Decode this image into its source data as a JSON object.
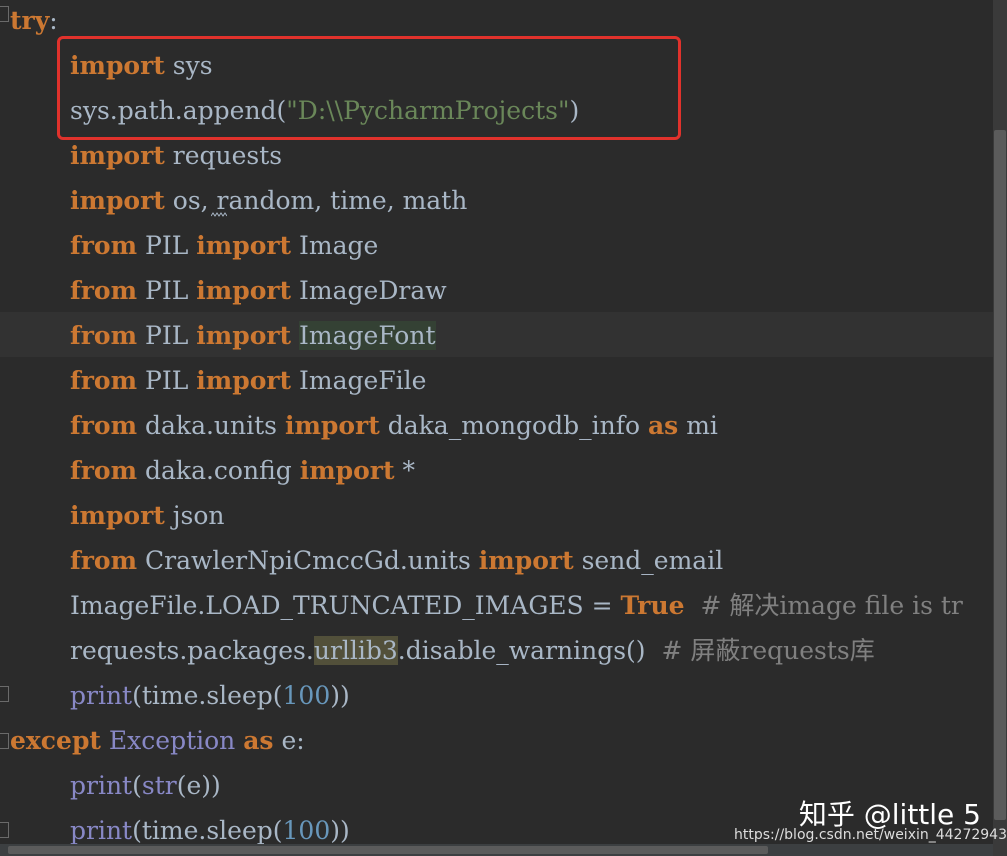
{
  "code": {
    "l1": {
      "kw": "try",
      "rest": ":"
    },
    "l2": {
      "kw": "import",
      "rest": " sys"
    },
    "l3": {
      "pre": "sys.path.append(",
      "str": "\"D:\\\\PycharmProjects\"",
      "post": ")"
    },
    "l4": {
      "kw": "import",
      "rest": " requests"
    },
    "l5": {
      "kw": "import",
      "rest": " os, random, time, math"
    },
    "l6": {
      "kw1": "from",
      "mod": " PIL ",
      "kw2": "import",
      "rest": " Image"
    },
    "l7": {
      "kw1": "from",
      "mod": " PIL ",
      "kw2": "import",
      "rest": " ImageDraw"
    },
    "l8": {
      "kw1": "from",
      "mod": " PIL ",
      "kw2": "import",
      "sp": " ",
      "hl": "ImageFont"
    },
    "l9": {
      "kw1": "from",
      "mod": " PIL ",
      "kw2": "import",
      "rest": " ImageFile"
    },
    "l10": {
      "kw1": "from",
      "mod": " daka.units ",
      "kw2": "import",
      "mid": " daka_mongodb_info ",
      "kw3": "as",
      "rest": " mi"
    },
    "l11": {
      "kw1": "from",
      "mod": " daka.config ",
      "kw2": "import",
      "rest": " *"
    },
    "l12": {
      "kw": "import",
      "rest": " json"
    },
    "l13": {
      "kw1": "from",
      "mod": " CrawlerNpiCmccGd.units ",
      "kw2": "import",
      "rest": " send_email"
    },
    "l14": {
      "pre": "ImageFile.LOAD_TRUNCATED_IMAGES = ",
      "kw": "True",
      "comment": "  # 解决image file is tr"
    },
    "l15": {
      "pre": "requests.packages.",
      "hl": "urllib3",
      "post": ".disable_warnings()",
      "comment": "  # 屏蔽requests库"
    },
    "l16": {
      "fn": "print",
      "a": "(time.sleep(",
      "num": "100",
      "b": "))"
    },
    "l17": {
      "kw": "except",
      "sp": " ",
      "exc": "Exception",
      "sp2": " ",
      "kw2": "as",
      "rest": " e:"
    },
    "l18": {
      "fn": "print",
      "a": "(",
      "fn2": "str",
      "b": "(e))"
    },
    "l19": {
      "fn": "print",
      "a": "(time.sleep(",
      "num": "100",
      "b": "))"
    }
  },
  "watermark": {
    "text": "知乎 @little 5",
    "url": "https://blog.csdn.net/weixin_44272943"
  },
  "colors": {
    "keyword": "#cc7832",
    "string": "#6a8759",
    "comment": "#808080",
    "number": "#6897bb",
    "builtin": "#8888c6",
    "text": "#a9b7c6",
    "background": "#2b2b2b",
    "highlight_box": "#e0322c"
  }
}
